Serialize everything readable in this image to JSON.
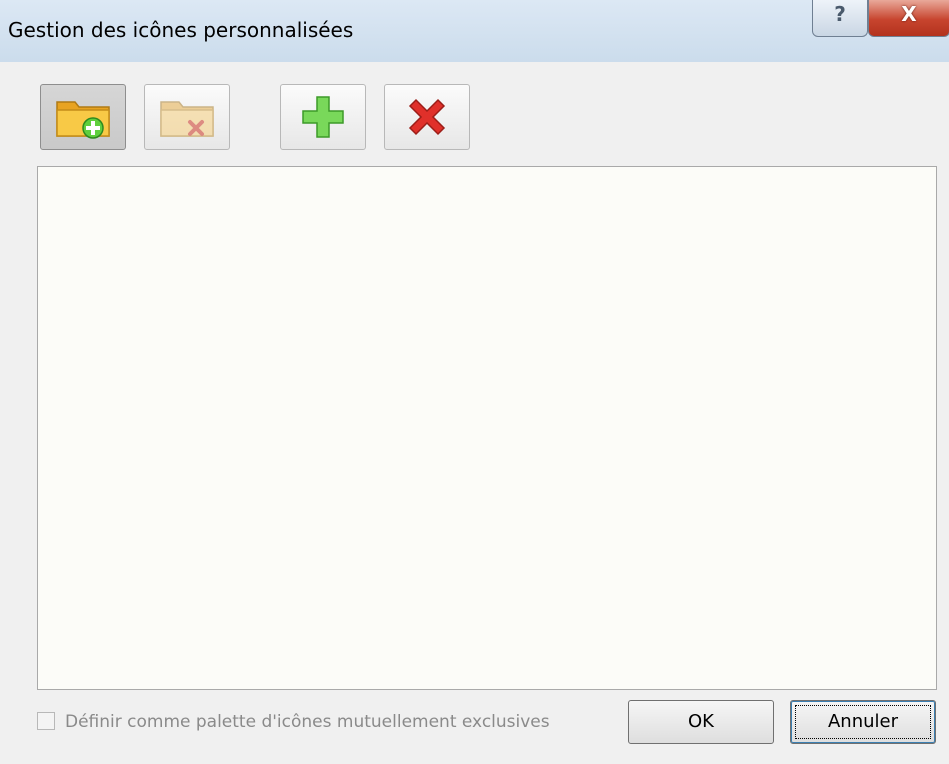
{
  "window": {
    "title": "Gestion des icônes personnalisées",
    "help_glyph": "?",
    "close_glyph": "X"
  },
  "toolbar": {
    "buttons": [
      {
        "name": "add-folder",
        "icon": "folder-add-icon",
        "state": "pressed"
      },
      {
        "name": "delete-folder",
        "icon": "folder-delete-icon",
        "state": "normal"
      },
      {
        "name": "add-icon",
        "icon": "green-plus-icon",
        "state": "normal"
      },
      {
        "name": "delete-icon",
        "icon": "red-x-icon",
        "state": "normal"
      }
    ]
  },
  "listbox": {
    "items": []
  },
  "options": {
    "exclusive_label": "Définir comme palette d'icônes mutuellement exclusives",
    "exclusive_checked": false,
    "exclusive_enabled": false
  },
  "buttons": {
    "ok_label": "OK",
    "cancel_label": "Annuler"
  },
  "colors": {
    "accent_green": "#5fcf3d",
    "accent_red": "#e0302a",
    "folder_yellow": "#f6c43a"
  }
}
